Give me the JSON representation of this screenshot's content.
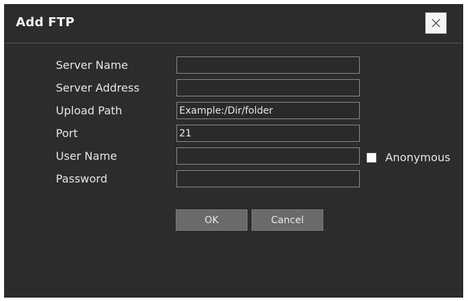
{
  "dialog": {
    "title": "Add FTP",
    "close_icon": "close-icon"
  },
  "form": {
    "server_name": {
      "label": "Server Name",
      "value": ""
    },
    "server_address": {
      "label": "Server Address",
      "value": ""
    },
    "upload_path": {
      "label": "Upload Path",
      "value": "",
      "placeholder": "Example:/Dir/folder"
    },
    "port": {
      "label": "Port",
      "value": "21"
    },
    "user_name": {
      "label": "User Name",
      "value": ""
    },
    "password": {
      "label": "Password",
      "value": ""
    },
    "anonymous": {
      "label": "Anonymous",
      "checked": false
    }
  },
  "buttons": {
    "ok_label": "OK",
    "cancel_label": "Cancel"
  },
  "colors": {
    "dialog_background": "#2c2c2c",
    "text": "#e6e6e6",
    "button": "#6a6a6a"
  }
}
